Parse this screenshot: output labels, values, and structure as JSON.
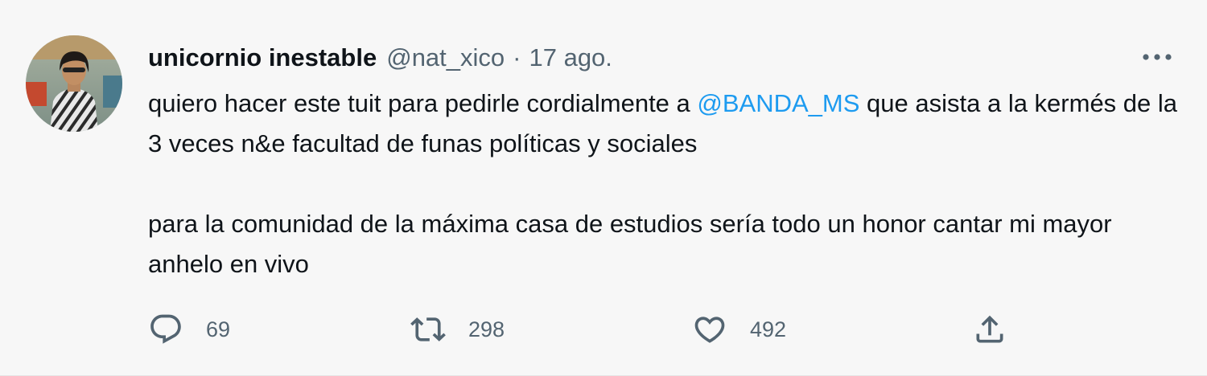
{
  "tweet": {
    "author_name": "unicornio inestable",
    "handle": "@nat_xico",
    "separator": "·",
    "date": "17 ago.",
    "text": {
      "p1_before": "quiero hacer este tuit para pedirle cordialmente a ",
      "mention": "@BANDA_MS",
      "p1_after": " que asista a la kermés de la 3 veces n&e facultad de funas políticas y sociales",
      "p2": "para la comunidad de la máxima casa de estudios sería todo un honor cantar mi mayor anhelo en vivo"
    },
    "stats": {
      "replies": "69",
      "retweets": "298",
      "likes": "492"
    }
  },
  "icons": {
    "more": "more-horizontal-icon",
    "reply": "reply-icon",
    "retweet": "retweet-icon",
    "like": "heart-icon",
    "share": "share-icon"
  },
  "colors": {
    "background": "#f7f7f7",
    "text": "#0f1419",
    "secondary": "#536471",
    "link": "#1d9bf0"
  }
}
